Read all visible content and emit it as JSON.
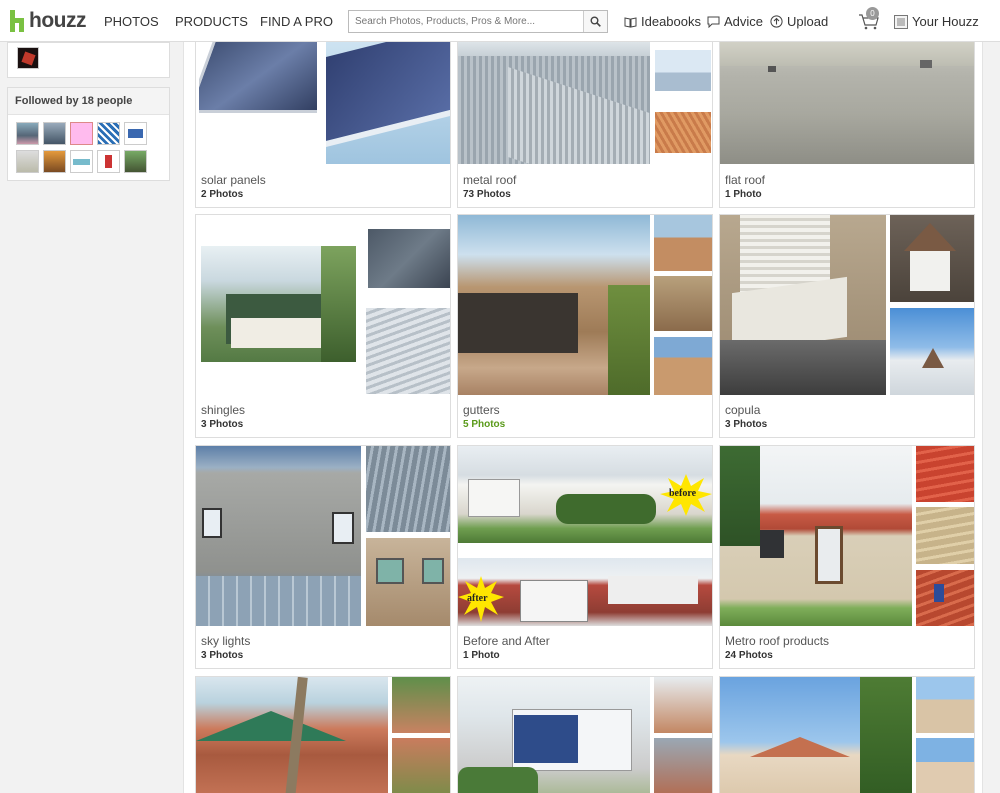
{
  "brand": {
    "name": "houzz"
  },
  "nav": {
    "photos": "PHOTOS",
    "products": "PRODUCTS",
    "find_pro": "FIND A PRO"
  },
  "search": {
    "placeholder": "Search Photos, Products, Pros & More..."
  },
  "top_links": {
    "ideabooks": "Ideabooks",
    "advice": "Advice",
    "upload": "Upload",
    "cart_count": "0",
    "your_houzz": "Your Houzz"
  },
  "sidebar": {
    "followed_title": "Followed by 18 people"
  },
  "cards": [
    {
      "title": "solar panels",
      "count": "2 Photos"
    },
    {
      "title": "metal roof",
      "count": "73 Photos"
    },
    {
      "title": "flat roof",
      "count": "1 Photo"
    },
    {
      "title": "shingles",
      "count": "3 Photos"
    },
    {
      "title": "gutters",
      "count": "5 Photos"
    },
    {
      "title": "copula",
      "count": "3 Photos"
    },
    {
      "title": "sky lights",
      "count": "3 Photos"
    },
    {
      "title": "Before and After",
      "count": "1 Photo"
    },
    {
      "title": "Metro roof products",
      "count": "24 Photos"
    }
  ],
  "labels": {
    "before": "before",
    "after": "after"
  },
  "colors": {
    "brand_green": "#7ac142",
    "count_green": "#5a9a1a",
    "border": "#dddddd"
  },
  "icons": [
    "houzz-logo-icon",
    "search-icon",
    "ideabook-icon",
    "advice-icon",
    "upload-icon",
    "cart-icon",
    "your-houzz-icon"
  ]
}
